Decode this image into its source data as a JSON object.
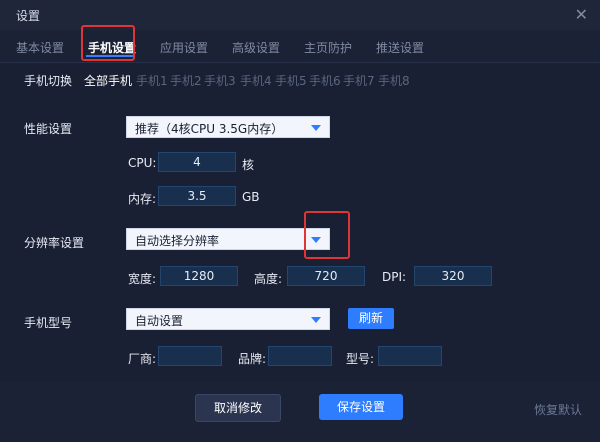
{
  "window": {
    "title": "设置"
  },
  "tabs": [
    "基本设置",
    "手机设置",
    "应用设置",
    "高级设置",
    "主页防护",
    "推送设置"
  ],
  "phone_switch": {
    "label": "手机切换",
    "items": [
      "全部手机",
      "手机1",
      "手机2",
      "手机3",
      "手机4",
      "手机5",
      "手机6",
      "手机7",
      "手机8"
    ]
  },
  "performance": {
    "label": "性能设置",
    "selected": "推荐（4核CPU 3.5G内存）",
    "cpu_label": "CPU:",
    "cpu_value": "4",
    "cpu_unit": "核",
    "mem_label": "内存:",
    "mem_value": "3.5",
    "mem_unit": "GB"
  },
  "resolution": {
    "label": "分辨率设置",
    "selected": "自动选择分辨率",
    "width_label": "宽度:",
    "width_value": "1280",
    "height_label": "高度:",
    "height_value": "720",
    "dpi_label": "DPI:",
    "dpi_value": "320"
  },
  "model": {
    "label": "手机型号",
    "selected": "自动设置",
    "refresh": "刷新",
    "vendor_label": "厂商:",
    "vendor_value": "",
    "brand_label": "品牌:",
    "brand_value": "",
    "model_label": "型号:",
    "model_value": ""
  },
  "footer": {
    "cancel": "取消修改",
    "save": "保存设置",
    "reset": "恢复默认"
  },
  "colors": {
    "accent": "#2f7dff",
    "highlight": "#e03535",
    "background": "#1a2033"
  }
}
